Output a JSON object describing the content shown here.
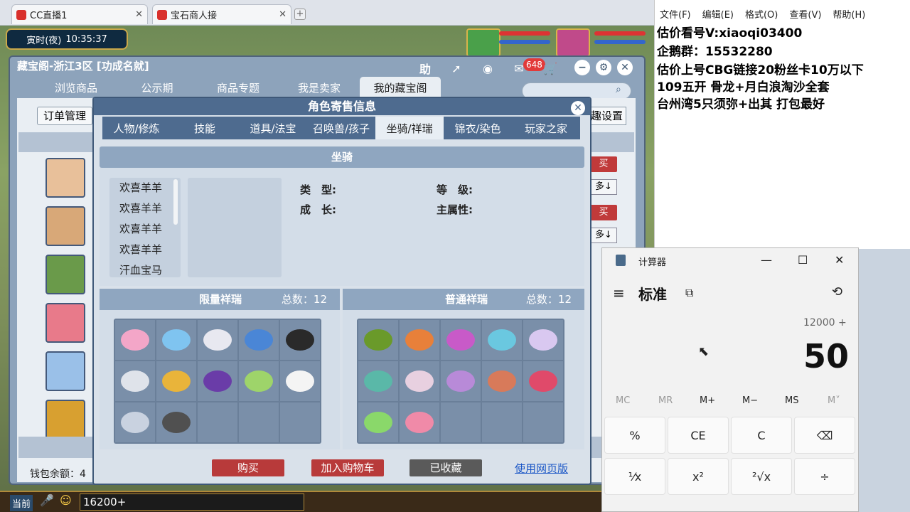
{
  "browser": {
    "tabs": [
      {
        "title": "CC直播1",
        "close": "✕"
      },
      {
        "title": "宝石商人接",
        "close": "✕"
      }
    ],
    "new_tab": "+"
  },
  "game": {
    "time_label": "寅时(夜)",
    "time": "10:35:37",
    "panel": {
      "title": "藏宝阁-浙江3区 [功成名就]",
      "help": "助",
      "badge": "648",
      "tabs": [
        "浏览商品",
        "公示期",
        "商品专题",
        "我是卖家",
        "我的藏宝阁"
      ],
      "active_tab": 4,
      "order_btn": "订单管理",
      "settings_btn": "趣设置",
      "wallet": "钱包余额：4",
      "buy": "买",
      "sort": "多↓"
    },
    "modal": {
      "title": "角色寄售信息",
      "close": "✕",
      "tabs": [
        "人物/修炼",
        "技能",
        "道具/法宝",
        "召唤兽/孩子",
        "坐骑/祥瑞",
        "锦衣/染色",
        "玩家之家"
      ],
      "active_tab": 4,
      "mount_section": "坐骑",
      "mounts": [
        "欢喜羊羊",
        "欢喜羊羊",
        "欢喜羊羊",
        "欢喜羊羊",
        "汗血宝马"
      ],
      "labels": {
        "type": "类　型:",
        "level": "等　级:",
        "growth": "成　长:",
        "main_attr": "主属性:"
      },
      "limited": {
        "title": "限量祥瑞",
        "count_label": "总数：",
        "count": "12",
        "colors": [
          "#f3a6c8",
          "#7fc4f0",
          "#e8e8f0",
          "#4a86d6",
          "#2a2a2a",
          "#dfe3ea",
          "#e9b43a",
          "#6a3ca8",
          "#9ed46a",
          "#f4f4f4",
          "#c9d2e0",
          "#505050"
        ]
      },
      "normal": {
        "title": "普通祥瑞",
        "count_label": "总数：",
        "count": "12",
        "colors": [
          "#6a9a2a",
          "#e8803a",
          "#c85ac8",
          "#6ac8e0",
          "#d9c8f0",
          "#5ab8a8",
          "#e8d0e0",
          "#b88ad8",
          "#d87a5a",
          "#e04a6a",
          "#8ad86a",
          "#f08aa8"
        ]
      },
      "buttons": {
        "buy": "购买",
        "add_cart": "加入购物车",
        "collected": "已收藏",
        "web": "使用网页版"
      }
    },
    "bottom": {
      "current": "当前",
      "money": "16200+"
    }
  },
  "notepad": {
    "menu": [
      "文件(F)",
      "编辑(E)",
      "格式(O)",
      "查看(V)",
      "帮助(H)"
    ],
    "lines": [
      "估价看号V:xiaoqi03400",
      "企鹅群：15532280",
      "估价上号CBG链接20粉丝卡10万以下",
      "109五开 骨龙+月白浪淘沙全套",
      "台州湾5只须弥+出其 打包最好"
    ]
  },
  "calculator": {
    "title": "计算器",
    "mode": "标准",
    "expression": "12000 +",
    "display": "50",
    "memory": [
      "MC",
      "MR",
      "M+",
      "M−",
      "MS",
      "M˅"
    ],
    "keys": [
      "%",
      "CE",
      "C",
      "⌫",
      "¹⁄x",
      "x²",
      "²√x",
      "÷"
    ]
  },
  "colors": {
    "accent": "#4e6b8f",
    "buy_red": "#b83a3a",
    "link": "#1a56c6"
  }
}
